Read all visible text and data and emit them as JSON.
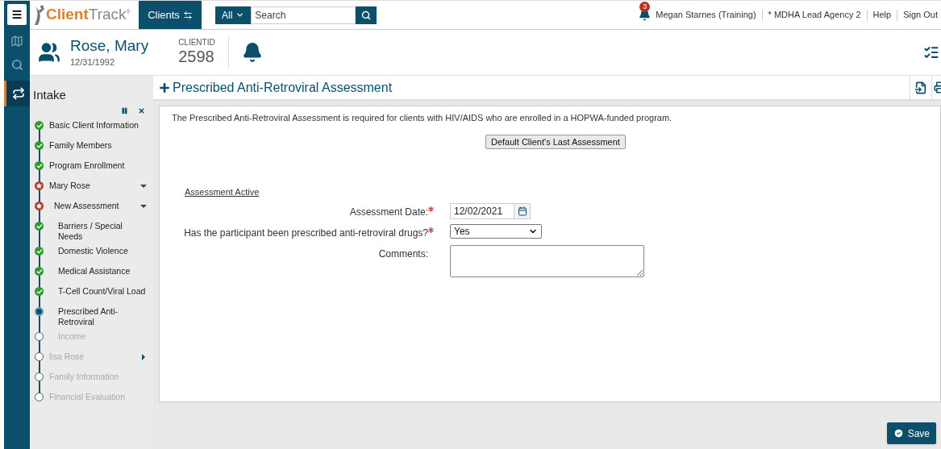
{
  "header": {
    "logo": {
      "part_a": "Client",
      "part_b": "Track",
      "mark": "®"
    },
    "clients_tab": "Clients",
    "search": {
      "scope": "All",
      "placeholder": "Search"
    },
    "notification_count": "3",
    "links": [
      "Megan Starnes (Training)",
      "* MDHA Lead Agency 2",
      "Help",
      "Sign Out"
    ]
  },
  "client": {
    "name": "Rose, Mary",
    "dob": "12/31/1992",
    "id_label": "CLIENTID",
    "id": "2598"
  },
  "workflow": {
    "title": "Intake",
    "steps": [
      {
        "label": "Basic Client Information",
        "kind": "complete"
      },
      {
        "label": "Family Members",
        "kind": "complete"
      },
      {
        "label": "Program Enrollment",
        "kind": "complete"
      },
      {
        "label": "Mary Rose",
        "kind": "required",
        "expanded": true,
        "children": [
          {
            "label": "New Assessment",
            "kind": "required",
            "expanded": true,
            "children": [
              {
                "label": "Barriers / Special Needs",
                "kind": "complete"
              },
              {
                "label": "Domestic Violence",
                "kind": "complete"
              },
              {
                "label": "Medical Assistance",
                "kind": "complete"
              },
              {
                "label": "T-Cell Count/Viral Load",
                "kind": "complete"
              },
              {
                "label": "Prescribed Anti-Retroviral",
                "kind": "current"
              },
              {
                "label": "Income",
                "kind": "pending"
              }
            ]
          }
        ]
      },
      {
        "label": "lisa Rose",
        "kind": "pending",
        "expanded": false
      },
      {
        "label": "Family Information",
        "kind": "pending"
      },
      {
        "label": "Financial Evaluation",
        "kind": "pending"
      }
    ]
  },
  "page": {
    "title": "Prescribed Anti-Retroviral Assessment",
    "description": "The Prescribed Anti-Retroviral Assessment is required for clients with HIV/AIDS who are enrolled in a HOPWA-funded program.",
    "default_button": "Default Client's Last Assessment",
    "section": "Assessment Active",
    "fields": [
      {
        "kind": "date",
        "label": "Assessment Date:",
        "required": true,
        "value": "12/02/2021"
      },
      {
        "kind": "select",
        "label": "Has the participant been prescribed anti-retroviral drugs?",
        "required": true,
        "value": "Yes"
      },
      {
        "kind": "textarea",
        "label": "Comments:",
        "required": false
      }
    ]
  },
  "save_button": "Save"
}
